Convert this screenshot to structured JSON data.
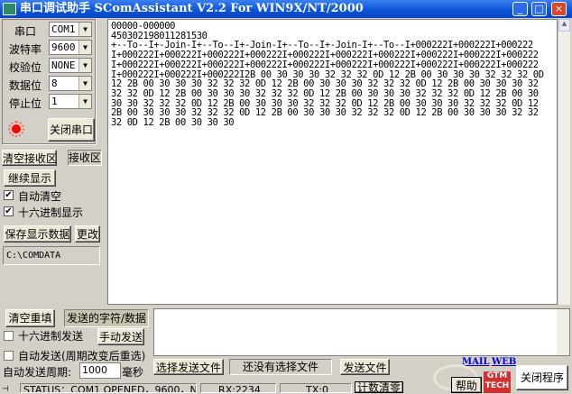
{
  "window": {
    "title": "串口调试助手  SComAssistant V2.2 For WIN9X/NT/2000",
    "min": "_",
    "max": "□",
    "close": "×"
  },
  "settings": [
    {
      "label": "串口",
      "value": "COM1"
    },
    {
      "label": "波特率",
      "value": "9600"
    },
    {
      "label": "校验位",
      "value": "NONE"
    },
    {
      "label": "数据位",
      "value": "8"
    },
    {
      "label": "停止位",
      "value": "1"
    }
  ],
  "led_color": "#ff0000",
  "close_port": "关闭串口",
  "clear_recv": "清空接收区",
  "recv_area_label": "接收区",
  "continue_display": "继续显示",
  "auto_clear": {
    "label": "自动清空",
    "checked": true
  },
  "hex_display": {
    "label": "十六进制显示",
    "checked": true
  },
  "save_data": "保存显示数据",
  "change": "更改",
  "save_path": "C:\\COMDATA",
  "recv_lines": [
    "00000-000000",
    "450302198011281530",
    "+--To--I+-Join-I+--To--I+-Join-I+--To--I+-Join-I+--To--I+000222I+000222I+000222",
    "I+000222I+000222I+000222I+000222I+000222I+000222I+000222I+000222I+000222I+000222",
    "I+000222I+000222I+000222I+000222I+000222I+000222I+000222I+000222I+000222I+000222",
    "I+000222I+000222I+000222I2B 00 30 30 30 32 32 32 0D 12 2B 00 30 30 30 32 32 32 0D",
    "12 2B 00 30 30 30 32 32 32 0D 12 2B 00 30 30 30 32 32 32 0D 12 2B 00 30 30 30 32",
    "32 32 0D 12 2B 00 30 30 30 32 32 32 0D 12 2B 00 30 30 30 32 32 32 0D 12 2B 00 30",
    "30 30 32 32 32 0D 12 2B 00 30 30 30 32 32 32 0D 12 2B 00 30 30 30 32 32 32 0D 12",
    "2B 00 30 30 30 32 32 32 0D 12 2B 00 30 30 30 32 32 32 0D 12 2B 00 30 30 30 32 32",
    "32 0D 12 2B 00 30 30 30"
  ],
  "clear_resend": "清空重填",
  "send_label": "发送的字符/数据",
  "send_text": "",
  "hex_send": {
    "label": "十六进制发送",
    "checked": false
  },
  "manual_send": "手动发送",
  "auto_send": {
    "label": "自动发送(周期改变后重选)",
    "checked": false
  },
  "period_label": "自动发送周期:",
  "period_value": "1000",
  "period_unit": "毫秒",
  "choose_file": "选择发送文件",
  "no_file": "还没有选择文件",
  "send_file": "发送文件",
  "mail": "MAIL",
  "web": "WEB",
  "help": "帮助",
  "close_app": "关闭程序",
  "status": {
    "text": "STATUS：COM1 OPENED，9600，N，8，1",
    "rx": "RX:2234",
    "tx": "TX:0",
    "reset": "计数清零"
  }
}
